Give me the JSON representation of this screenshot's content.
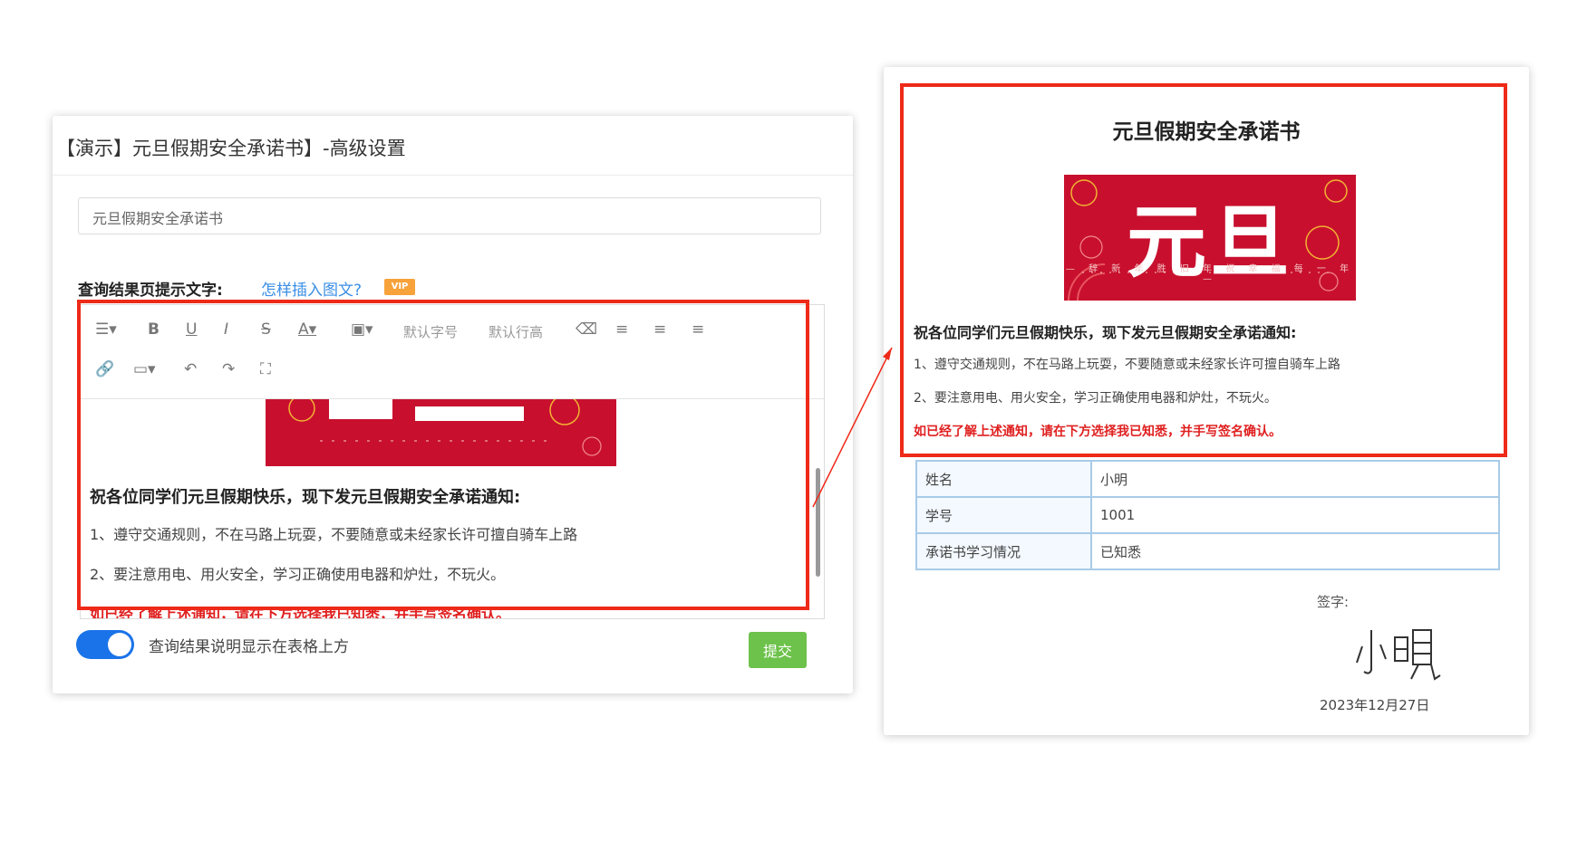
{
  "editor_panel": {
    "window_title": "【演示】元旦假期安全承诺书】-高级设置",
    "title_input_value": "元旦假期安全承诺书",
    "section_label": "查询结果页提示文字:",
    "insert_link": "怎样插入图文?",
    "vip_badge": "VIP",
    "toolbar": {
      "buttons": [
        "indent-icon",
        "bold-icon",
        "underline-icon",
        "italic-icon",
        "strikethrough-icon",
        "font-color-icon",
        "background-color-icon",
        "eraser-icon",
        "align-left-icon",
        "align-center-icon",
        "align-right-icon",
        "link-icon",
        "image-icon",
        "undo-icon",
        "redo-icon",
        "fullscreen-icon"
      ],
      "font_size_default": "默认字号",
      "line_height_default": "默认行高"
    },
    "content": {
      "heading": "祝各位同学们元旦假期快乐，现下发元旦假期安全承诺通知:",
      "item1": "1、遵守交通规则，不在马路上玩耍，不要随意或未经家长许可擅自骑车上路",
      "item2": "2、要注意用电、用火安全，学习正确使用电器和炉灶，不玩火。",
      "notice": "如已经了解上述通知，请在下方选择我已知悉，并手写签名确认。"
    },
    "toggle_label": "查询结果说明显示在表格上方",
    "toggle_on": true,
    "submit_label": "提交"
  },
  "preview_panel": {
    "title": "元旦假期安全承诺书",
    "banner": {
      "big_text": "元旦",
      "sub_text": "— 辞 新 年 胜 旧 年   祝 幸 福 每 一 年 —"
    },
    "heading": "祝各位同学们元旦假期快乐，现下发元旦假期安全承诺通知:",
    "item1": "1、遵守交通规则，不在马路上玩耍，不要随意或未经家长许可擅自骑车上路",
    "item2": "2、要注意用电、用火安全，学习正确使用电器和炉灶，不玩火。",
    "notice": "如已经了解上述通知，请在下方选择我已知悉，并手写签名确认。",
    "table": [
      {
        "key": "姓名",
        "value": "小明"
      },
      {
        "key": "学号",
        "value": "1001"
      },
      {
        "key": "承诺书学习情况",
        "value": "已知悉"
      }
    ],
    "signature_label": "签字:",
    "signature_name": "小明",
    "date": "2023年12月27日"
  },
  "colors": {
    "highlight": "#ee2a18",
    "toggle_on": "#1a73e8",
    "submit": "#6cc24a",
    "banner_red": "#c8102e",
    "notice_red": "#e02020",
    "link": "#3a8ee6"
  }
}
